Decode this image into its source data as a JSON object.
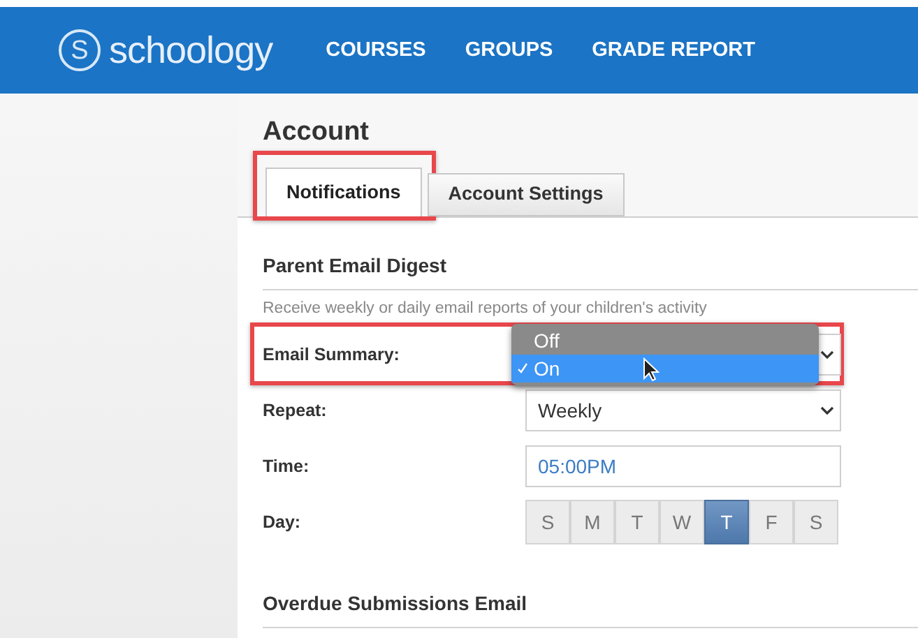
{
  "nav": {
    "logo_mark": "S",
    "logo": "schoology",
    "items": [
      {
        "label": "COURSES"
      },
      {
        "label": "GROUPS"
      },
      {
        "label": "GRADE REPORT"
      }
    ]
  },
  "page": {
    "title": "Account"
  },
  "tabs": [
    {
      "label": "Notifications",
      "selected": true,
      "highlighted": true
    },
    {
      "label": "Account Settings",
      "selected": false,
      "highlighted": false
    }
  ],
  "sections": [
    {
      "title": "Parent Email Digest",
      "description": "Receive weekly or daily email reports of your children's activity",
      "fields": [
        {
          "kind": "select",
          "label": "Email Summary:",
          "highlighted": true,
          "open": true,
          "options": [
            {
              "label": "Off",
              "selected": false
            },
            {
              "label": "On",
              "selected": true
            }
          ]
        },
        {
          "kind": "select",
          "label": "Repeat:",
          "value": "Weekly"
        },
        {
          "kind": "time",
          "label": "Time:",
          "value": "05:00PM"
        },
        {
          "kind": "days",
          "label": "Day:",
          "days": [
            {
              "label": "S",
              "selected": false
            },
            {
              "label": "M",
              "selected": false
            },
            {
              "label": "T",
              "selected": false
            },
            {
              "label": "W",
              "selected": false
            },
            {
              "label": "T",
              "selected": true
            },
            {
              "label": "F",
              "selected": false
            },
            {
              "label": "S",
              "selected": false
            }
          ]
        }
      ]
    },
    {
      "title": "Overdue Submissions Email"
    }
  ]
}
